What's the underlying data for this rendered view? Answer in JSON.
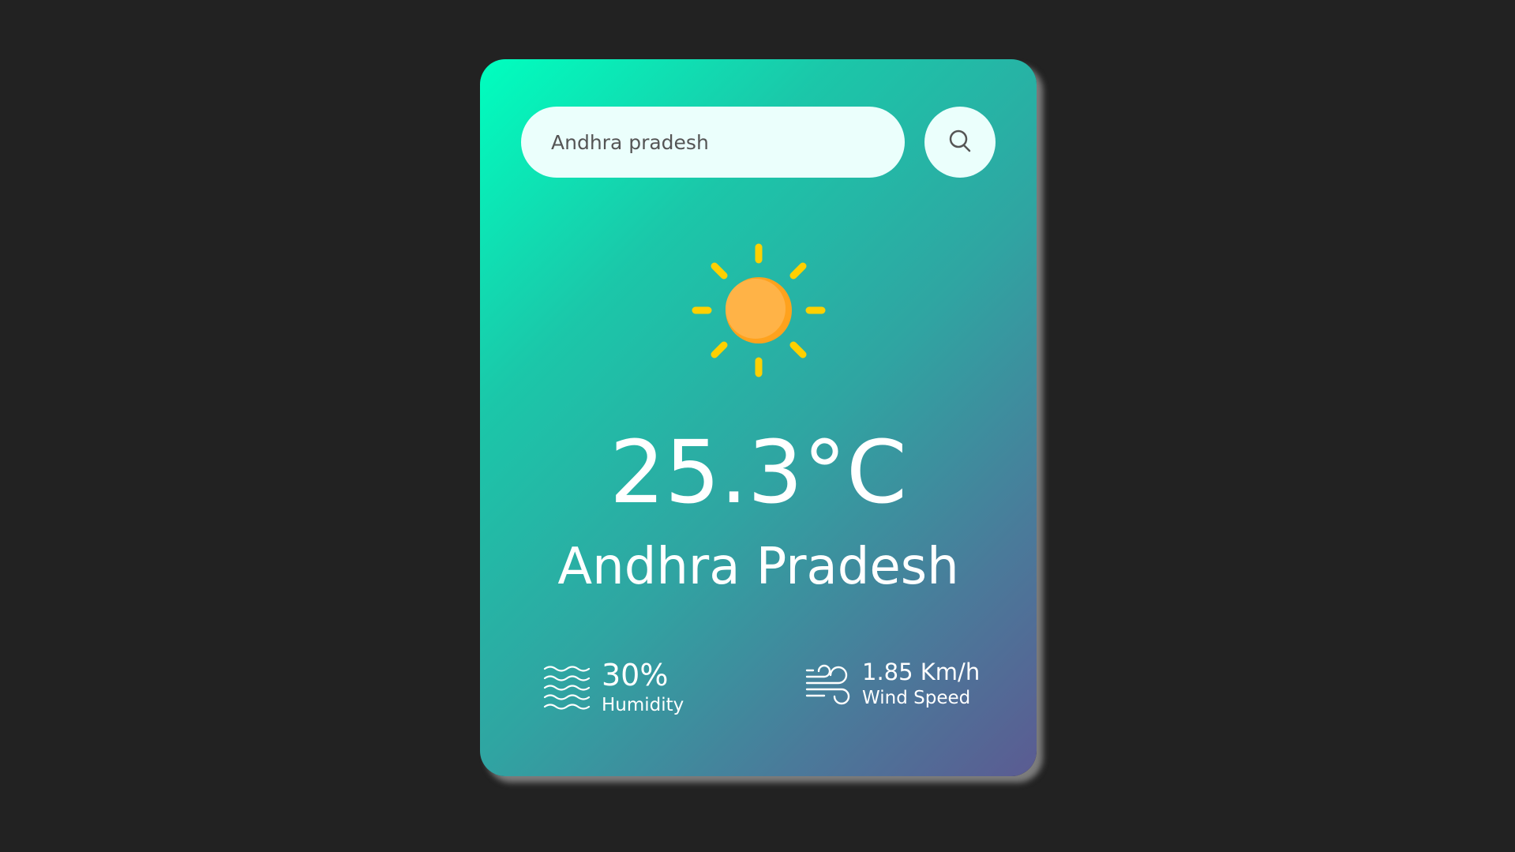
{
  "search": {
    "value": "Andhra pradesh",
    "button_icon": "search-icon"
  },
  "weather": {
    "icon": "sun-icon",
    "temperature": "25.3°C",
    "city": "Andhra Pradesh"
  },
  "details": {
    "humidity": {
      "icon": "humidity-waves-icon",
      "value": "30%",
      "label": "Humidity"
    },
    "wind": {
      "icon": "wind-icon",
      "value": "1.85 Km/h",
      "label": "Wind Speed"
    }
  },
  "colors": {
    "page_background": "#222222",
    "card_gradient_start": "#00ffbf",
    "card_gradient_end": "#5b5b92",
    "input_background": "#ebfffc",
    "sun_core": "#ffb13b",
    "sun_rays": "#ffd000"
  }
}
